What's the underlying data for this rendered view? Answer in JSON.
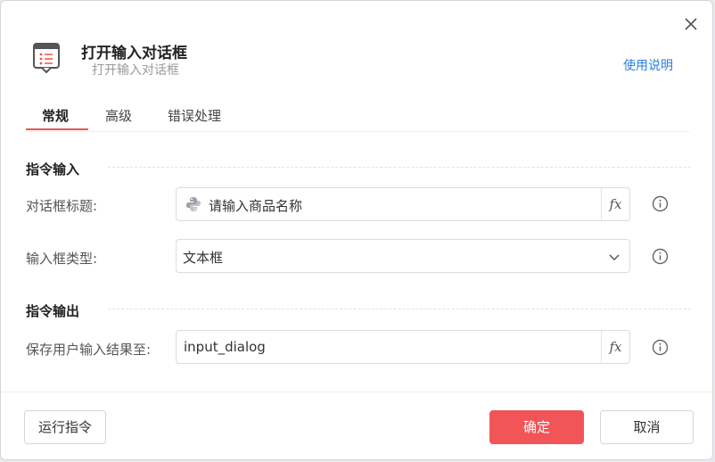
{
  "dialog": {
    "title": "打开输入对话框",
    "subtitle": "打开输入对话框",
    "help_link": "使用说明",
    "app_icon": "list-document-icon",
    "close_icon": "close-icon"
  },
  "tabs": [
    {
      "label": "常规",
      "active": true
    },
    {
      "label": "高级",
      "active": false
    },
    {
      "label": "错误处理",
      "active": false
    }
  ],
  "sections": {
    "input_title": "指令输入",
    "output_title": "指令输出"
  },
  "fields": {
    "dialog_title": {
      "label": "对话框标题:",
      "value": "请输入商品名称",
      "prefix_icon": "python-icon",
      "fx_label": "𝑓x"
    },
    "input_type": {
      "label": "输入框类型:",
      "value": "文本框",
      "chevron_icon": "chevron-down-icon"
    },
    "save_result": {
      "label": "保存用户输入结果至:",
      "value": "input_dialog",
      "fx_label": "𝑓x"
    }
  },
  "footer": {
    "run_label": "运行指令",
    "ok_label": "确定",
    "cancel_label": "取消"
  },
  "colors": {
    "accent": "#f25557",
    "link": "#2a7ee0"
  }
}
